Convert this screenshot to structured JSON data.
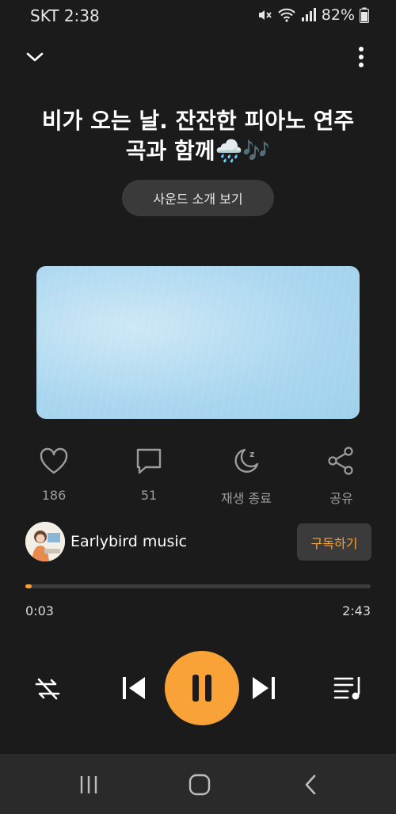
{
  "status_bar": {
    "carrier_time": "SKT 2:38",
    "battery": "82%",
    "icons": [
      "mute-icon",
      "wifi-icon",
      "signal-icon",
      "battery-icon"
    ]
  },
  "header": {
    "title": "비가 오는 날. 잔잔한 피아노 연주곡과 함께🌧️🎶",
    "intro_button": "사운드 소개 보기"
  },
  "actions": {
    "like": {
      "icon": "heart-icon",
      "label": "186"
    },
    "comment": {
      "icon": "comment-icon",
      "label": "51"
    },
    "sleep": {
      "icon": "moon-icon",
      "label": "재생 종료"
    },
    "share": {
      "icon": "share-icon",
      "label": "공유"
    }
  },
  "channel": {
    "name": "Earlybird music",
    "subscribe_label": "구독하기"
  },
  "player": {
    "current_time": "0:03",
    "total_time": "2:43",
    "progress_fraction": 0.018,
    "state": "playing"
  },
  "colors": {
    "accent": "#f8a238",
    "background": "#1b1b1b",
    "button_bg": "#3a3a3a"
  }
}
